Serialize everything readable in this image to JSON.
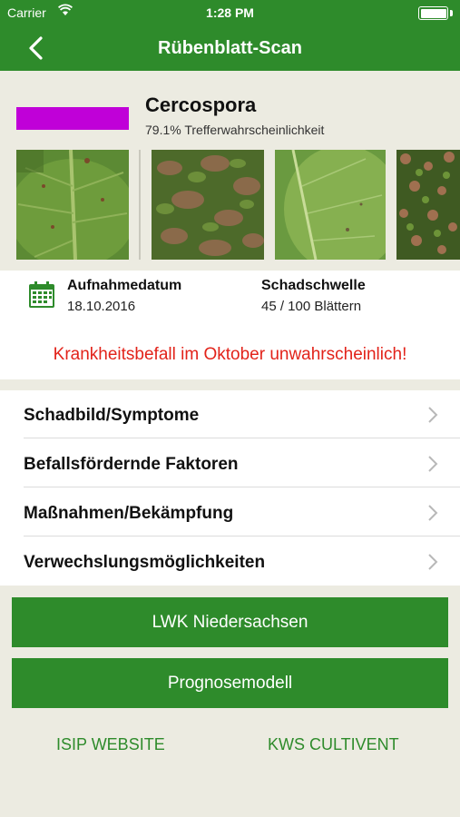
{
  "status_bar": {
    "carrier": "Carrier",
    "time": "1:28 PM"
  },
  "nav": {
    "title": "Rübenblatt-Scan",
    "back_icon": "chevron-left-icon"
  },
  "result": {
    "color": "#c000d8",
    "disease": "Cercospora",
    "probability": "79.1% Trefferwahrscheinlichkeit",
    "photos": [
      "leaf-closeup-spots",
      "field-damaged-leaves",
      "leaf-underside",
      "field-overview"
    ]
  },
  "info": {
    "date_label": "Aufnahmedatum",
    "date_value": "18.10.2016",
    "threshold_label": "Schadschwelle",
    "threshold_value": "45 / 100 Blättern",
    "warning": "Krankheitsbefall im Oktober unwahrscheinlich!",
    "warning_color": "#e2231a"
  },
  "menu": [
    {
      "label": "Schadbild/Symptome"
    },
    {
      "label": "Befallsfördernde Faktoren"
    },
    {
      "label": "Maßnahmen/Bekämpfung"
    },
    {
      "label": "Verwechslungsmöglichkeiten"
    }
  ],
  "buttons": {
    "lwk": "LWK Niedersachsen",
    "prognose": "Prognosemodell"
  },
  "links": {
    "isip": "ISIP WEBSITE",
    "kws": "KWS CULTIVENT"
  },
  "theme": {
    "accent": "#2e8b2b",
    "background": "#ecebe1"
  }
}
